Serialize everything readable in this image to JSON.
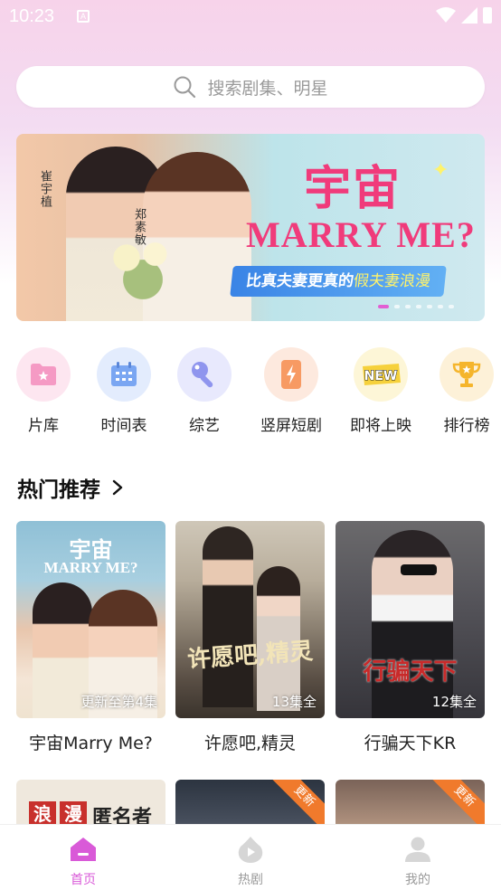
{
  "status": {
    "time": "10:23",
    "notif_glyph": "A"
  },
  "search": {
    "placeholder": "搜索剧集、明星"
  },
  "banner": {
    "title_line1": "宇宙",
    "title_line2": "MARRY ME?",
    "subtitle_prefix": "比真夫妻更真的",
    "subtitle_highlight": "假夫妻浪漫",
    "actor1": "崔宇植",
    "actor2": "郑素敏"
  },
  "quick_nav": [
    {
      "label": "片库",
      "icon": "folder-star-icon"
    },
    {
      "label": "时间表",
      "icon": "calendar-icon"
    },
    {
      "label": "综艺",
      "icon": "magic-wand-icon"
    },
    {
      "label": "竖屏短剧",
      "icon": "phone-bolt-icon"
    },
    {
      "label": "即将上映",
      "icon": "new-badge-icon"
    },
    {
      "label": "排行榜",
      "icon": "trophy-icon"
    }
  ],
  "hot": {
    "title": "热门推荐",
    "items": [
      {
        "title": "宇宙Marry Me?",
        "badge": "更新至第4集",
        "poster_line1": "宇宙",
        "poster_line2": "MARRY ME?"
      },
      {
        "title": "许愿吧,精灵",
        "badge": "13集全",
        "poster_line1": "许愿吧,精灵"
      },
      {
        "title": "行骗天下KR",
        "badge": "12集全",
        "poster_line1": "行骗天下"
      }
    ]
  },
  "row2": [
    {
      "poster_text1": "浪",
      "poster_text2": "漫",
      "poster_text3": "匿名者"
    },
    {
      "ribbon": "更新"
    },
    {
      "ribbon": "更新"
    }
  ],
  "tabs": [
    {
      "label": "首页",
      "icon": "home-icon",
      "active": true
    },
    {
      "label": "热剧",
      "icon": "play-flame-icon",
      "active": false
    },
    {
      "label": "我的",
      "icon": "user-icon",
      "active": false
    }
  ],
  "colors": {
    "accent": "#d95ad8",
    "banner_title": "#f03b7b",
    "ribbon": "#f07a2c"
  }
}
